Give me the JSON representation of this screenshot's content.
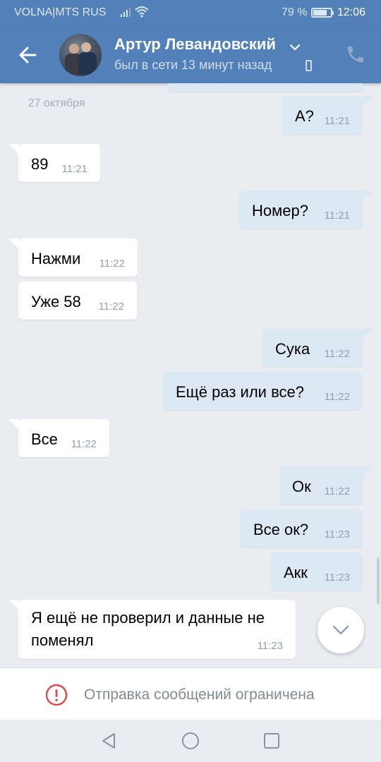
{
  "status_bar": {
    "carrier": "VOLNA|MTS RUS",
    "battery_percent": "79 %",
    "battery_level": 0.79,
    "time": "12:06",
    "icons": [
      "signal-icon",
      "wifi-icon",
      "battery-icon"
    ]
  },
  "header": {
    "contact_name": "Артур Левандовский",
    "last_seen": "был в сети 13 минут назад",
    "icons": [
      "back-arrow-icon",
      "chevron-down-icon",
      "mobile-phone-icon",
      "call-icon"
    ]
  },
  "chat": {
    "date_separator": "27 октября",
    "messages": [
      {
        "dir": "out",
        "text": "А?",
        "time": "11:21"
      },
      {
        "dir": "in",
        "text": "89",
        "time": "11:21"
      },
      {
        "dir": "out",
        "text": "Номер?",
        "time": "11:21"
      },
      {
        "dir": "in",
        "text": "Нажми",
        "time": "11:22"
      },
      {
        "dir": "in",
        "text": "Уже 58",
        "time": "11:22"
      },
      {
        "dir": "out",
        "text": "Сука",
        "time": "11:22"
      },
      {
        "dir": "out",
        "text": "Ещё раз или все?",
        "time": "11:22"
      },
      {
        "dir": "in",
        "text": "Все",
        "time": "11:22"
      },
      {
        "dir": "out",
        "text": "Ок",
        "time": "11:22"
      },
      {
        "dir": "out",
        "text": "Все ок?",
        "time": "11:23"
      },
      {
        "dir": "out",
        "text": "Акк",
        "time": "11:23"
      },
      {
        "dir": "in",
        "text": "Я ещё не проверил и данные не поменял",
        "time": "11:23"
      }
    ]
  },
  "footer": {
    "restriction_message": "Отправка сообщений ограничена",
    "restriction_color": "#e64646"
  },
  "colors": {
    "header_bg": "#5181b8",
    "chat_bg": "#e9ecf0",
    "outgoing_bubble": "#dde8f5",
    "incoming_bubble": "#ffffff"
  }
}
